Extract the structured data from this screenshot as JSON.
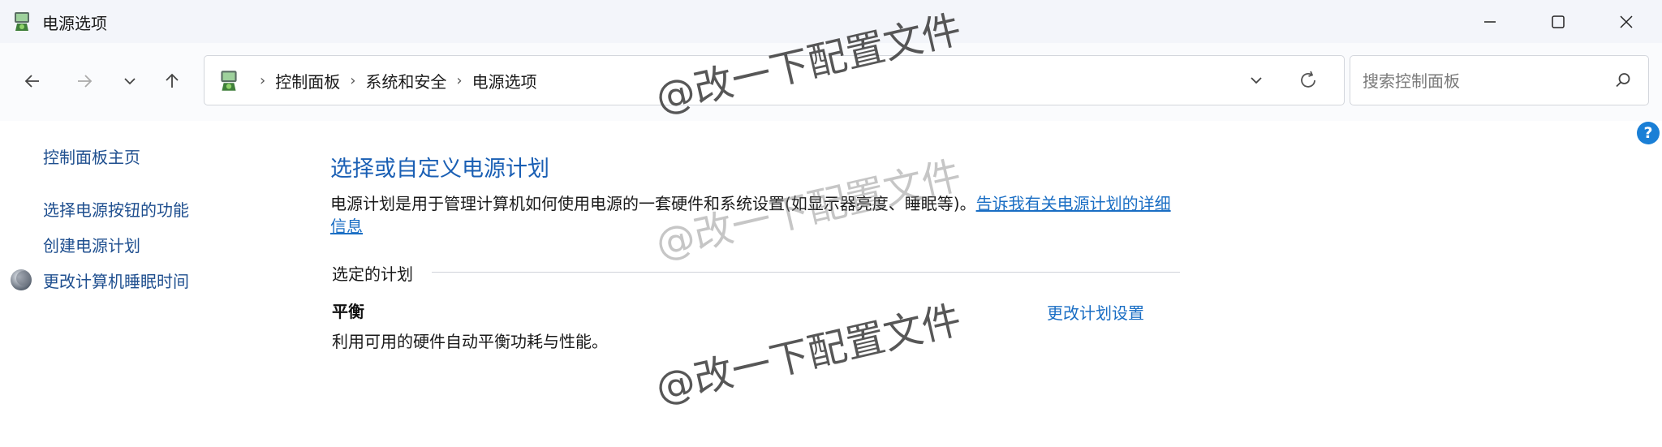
{
  "window": {
    "title": "电源选项",
    "app_icon": "power-options-icon"
  },
  "navigation": {
    "back_icon": "arrow-left-icon",
    "forward_icon": "arrow-right-icon",
    "recent_icon": "chevron-down-icon",
    "up_icon": "arrow-up-icon"
  },
  "address_bar": {
    "breadcrumbs": [
      "控制面板",
      "系统和安全",
      "电源选项"
    ]
  },
  "search": {
    "placeholder": "搜索控制面板"
  },
  "help": {
    "label": "?"
  },
  "sidebar": {
    "home": "控制面板主页",
    "items": [
      "选择电源按钮的功能",
      "创建电源计划",
      "更改计算机睡眠时间"
    ]
  },
  "main": {
    "title": "选择或自定义电源计划",
    "description": "电源计划是用于管理计算机如何使用电源的一套硬件和系统设置(如显示器亮度、睡眠等)。",
    "description_link": "告诉我有关电源计划的详细信息",
    "selected_plan_label": "选定的计划",
    "plan": {
      "name": "平衡",
      "description": "利用可用的硬件自动平衡功耗与性能。",
      "settings_link": "更改计划设置"
    }
  },
  "watermark": {
    "text": "@改一下配置文件"
  },
  "colors": {
    "heading": "#1a5fb4",
    "link": "#1a6ec4",
    "sidebar_link": "#1f4f8f",
    "help": "#1a7fd6"
  }
}
